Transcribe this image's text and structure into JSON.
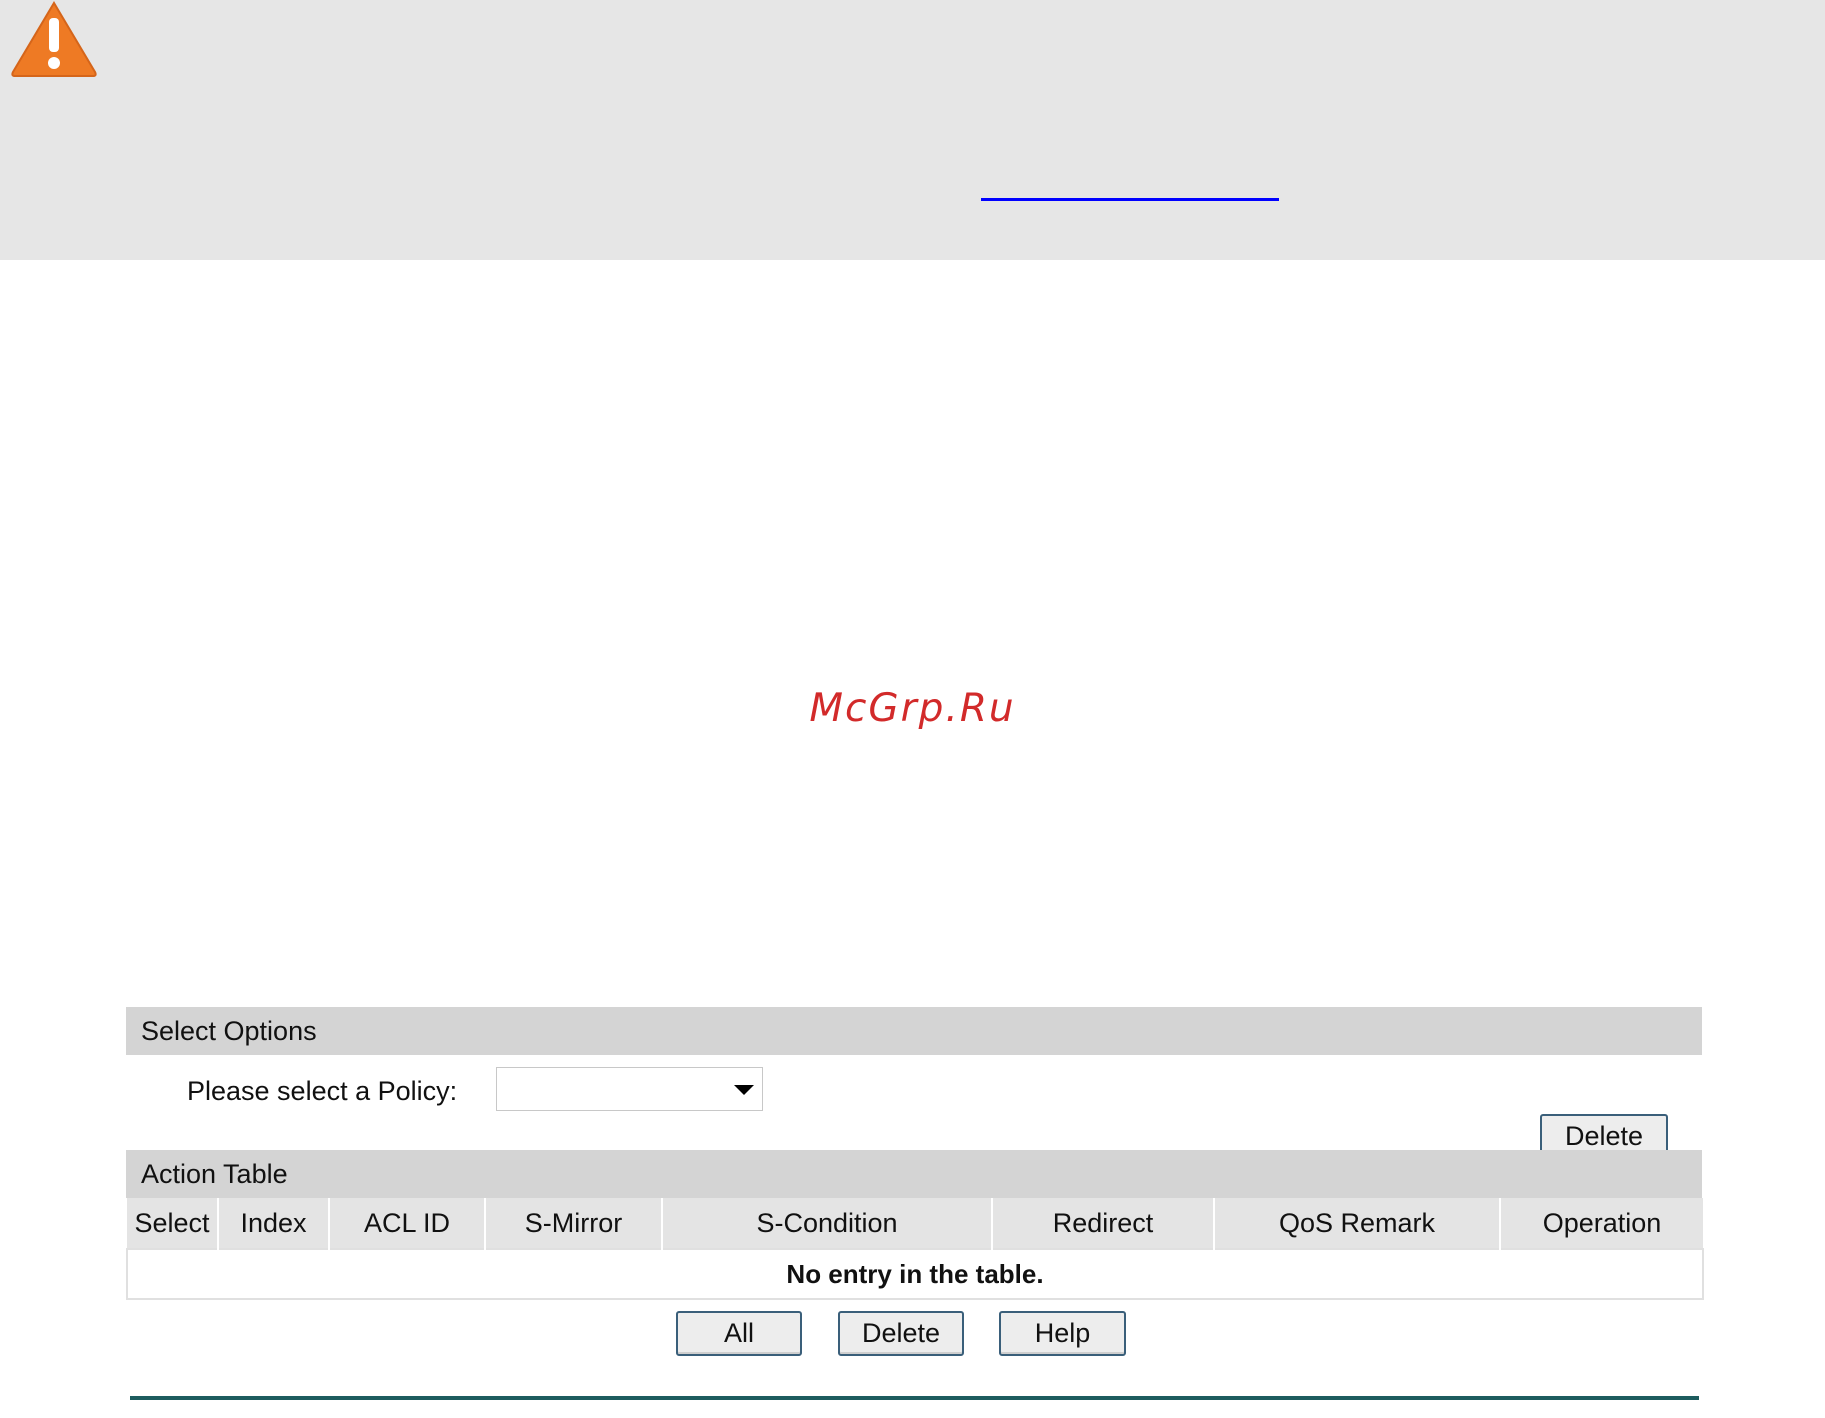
{
  "watermark": "McGrp.Ru",
  "select_options": {
    "header": "Select Options",
    "policy_label": "Please select a Policy:",
    "policy_value": "",
    "delete_button": "Delete"
  },
  "action_table": {
    "header": "Action Table",
    "columns": [
      "Select",
      "Index",
      "ACL ID",
      "S-Mirror",
      "S-Condition",
      "Redirect",
      "QoS Remark",
      "Operation"
    ],
    "empty_message": "No entry in the table."
  },
  "buttons": {
    "all": "All",
    "delete": "Delete",
    "help": "Help"
  },
  "colors": {
    "warning_icon": "#ee7a24",
    "section_header": "#d4d4d4",
    "button_border": "#3a5f7a",
    "bottom_rule": "#1d5c5e",
    "watermark": "#d22a2a"
  },
  "icons": {
    "warning": "warning-icon"
  }
}
